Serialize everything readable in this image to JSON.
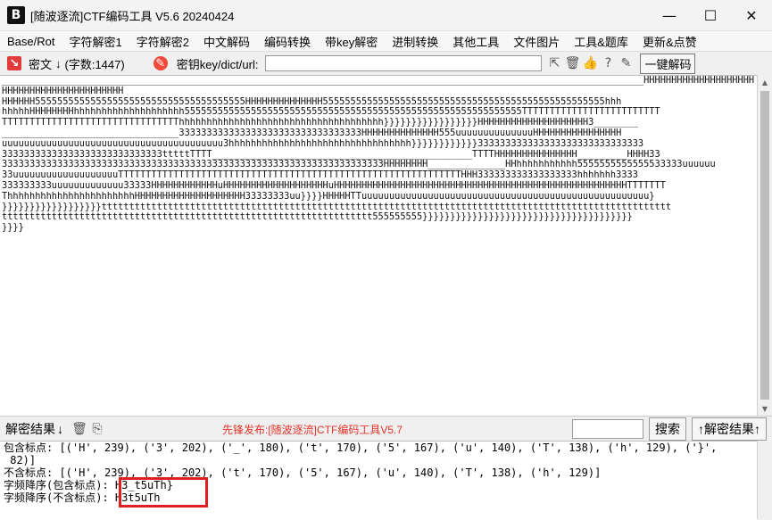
{
  "window": {
    "title": "[随波逐流]CTF编码工具 V5.6 20240424",
    "app_icon_text": "B",
    "controls": [
      "—",
      "☐",
      "✕"
    ]
  },
  "menu": [
    "Base/Rot",
    "字符解密1",
    "字符解密2",
    "中文解码",
    "编码转换",
    "带key解密",
    "进制转换",
    "其他工具",
    "文件图片",
    "工具&题库",
    "更新&点赞"
  ],
  "toolbar": {
    "ciphertext_label": "密文",
    "arrow": "↓",
    "char_count": "(字数:1447)",
    "key_label": "密钥key/dict/url:",
    "key_value": "",
    "decode_button": "一键解码"
  },
  "ciphertext": "____________________________________________________________________________________________________________________HHHHHHHHHHHHHHHHHHHHHHHHHHHHHHHHHHHHHHHHHH\nHHHHHH55555555555555555555555555555555555555HHHHHHHHHHHHHH555555555555555555555555555555555555555555555555555hhh\nhhhhhHHHHHHHHhhhhhhhhhhhhhhhhhhhh5555555555555555555555555555555555555555555555555555555555555TTTTTTTTTTTTTTTTTTTTTTTTT\nTTTTTTTTTTTTTTTTTTTTTTTTTTTTTTTThhhhhhhhhhhhhhhhhhhhhhhhhhhhhhhhhhhhh}}}}}}}}}}}}}}}}}HHHHHHHHHHHHHHHHHHHH3________\n________________________________333333333333333333333333333333333HHHHHHHHHHHHHH555uuuuuuuuuuuuuuHHHHHHHHHHHHHHHH\nuuuuuuuuuuuuuuuuuuuuuuuuuuuuuuuuuuuuuuuu3hhhhhhhhhhhhhhhhhhhhhhhhhhhhhhhhh}}}}}}}}}}}}333333333333333333333333333333\n33333333333333333333333333333tttttTTTT_______________________________________________TTTTHHHHHHHHHHHHHHH_________HHHH33\n333333333333333333333333333333333333333333333333333333333333333333333HHHHHHHH______________HHhhhhhhhhhhh5555555555555533333uuuuuu\n33uuuuuuuuuuuuuuuuuuuTTTTTTTTTTTTTTTTTTTTTTTTTTTTTTTTTTTTTTTTTTTTTTTTTTTTTTTTTTTTTTHHH333333333333333333hhhhhhh3333\n333333333uuuuuuuuuuuuu33333HHHHHHHHHHHHuHHHHHHHHHHHHHHHHHHHuHHHHHHHHHHHHHHHHHHHHHHHHHHHHHHHHHHHHHHHHHHHHHHHHHHHHHTTTTTTT\nThhhhhhhhhhhhhhhhhhhhhhhHHHHHHHHHHHHHHHHHHHH33333333uu}}}}HHHHHTTuuuuuuuuuuuuuuuuuuuuuuuuuuuuuuuuuuuuuuuuuuuuuuuuuuuu}\n}}}}}}}}}}}}}}}}}}ttttttttttttttttttttttttttttttttttttttttttttttttttttttttttttttttttttttttttttttttttttttttttttttttttttttt\nttttttttttttttttttttttttttttttttttttttttttttttttttttttttttttttttttt555555555}}}}}}}}}}}}}}}}}}}}}}}}}}}}}}}}}}}}}}\n}}}}",
  "result_bar": {
    "label": "解密结果",
    "arrow": "↓",
    "notice": "先锋发布:[随波逐流]CTF编码工具V5.7",
    "search_button": "搜索",
    "result_up_button": "↑解密结果↑"
  },
  "output_lines": [
    "包含标点: [('H', 239), ('3', 202), ('_', 180), ('t', 170), ('5', 167), ('u', 140), ('T', 138), ('h', 129), ('}',",
    " 82)]",
    "不含标点: [('H', 239), ('3', 202), ('t', 170), ('5', 167), ('u', 140), ('T', 138), ('h', 129)]",
    "字频降序(包含标点): H3_t5uTh}",
    "字频降序(不含标点): H3t5uTh"
  ]
}
